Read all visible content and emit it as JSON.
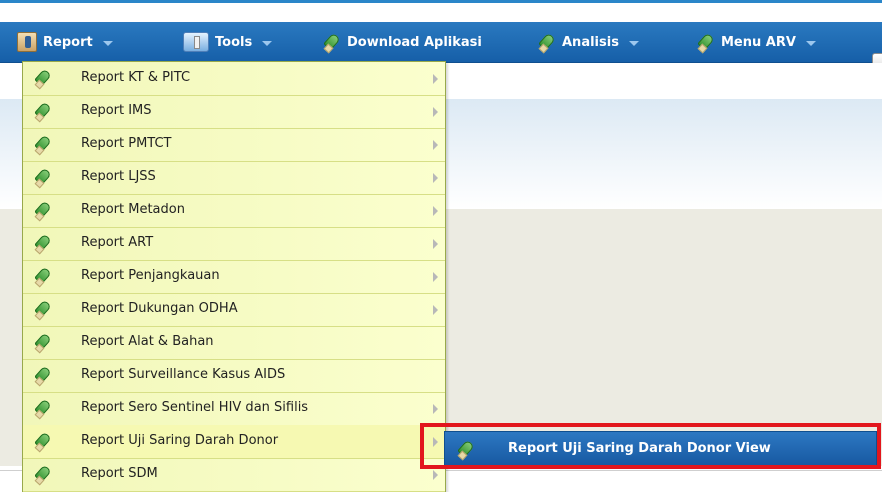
{
  "menubar": {
    "items": [
      {
        "label": "Report",
        "icon": "report-icon",
        "has_caret": true
      },
      {
        "label": "Tools",
        "icon": "tools-icon",
        "has_caret": true
      },
      {
        "label": "Download Aplikasi",
        "icon": "pencil-icon",
        "has_caret": false
      },
      {
        "label": "Analisis",
        "icon": "pencil-icon",
        "has_caret": true
      },
      {
        "label": "Menu ARV",
        "icon": "pencil-icon",
        "has_caret": true
      }
    ]
  },
  "report_menu": {
    "items": [
      {
        "label": "Report KT & PITC",
        "has_submenu": true
      },
      {
        "label": "Report IMS",
        "has_submenu": true
      },
      {
        "label": "Report PMTCT",
        "has_submenu": true
      },
      {
        "label": "Report LJSS",
        "has_submenu": true
      },
      {
        "label": "Report Metadon",
        "has_submenu": true
      },
      {
        "label": "Report ART",
        "has_submenu": true
      },
      {
        "label": "Report Penjangkauan",
        "has_submenu": true
      },
      {
        "label": "Report Dukungan ODHA",
        "has_submenu": true
      },
      {
        "label": "Report Alat & Bahan",
        "has_submenu": false
      },
      {
        "label": "Report Surveillance Kasus AIDS",
        "has_submenu": false
      },
      {
        "label": "Report Sero Sentinel HIV dan Sifilis",
        "has_submenu": true
      },
      {
        "label": "Report Uji Saring Darah Donor",
        "has_submenu": true
      },
      {
        "label": "Report SDM",
        "has_submenu": true
      }
    ]
  },
  "submenu": {
    "label": "Report Uji Saring Darah Donor View"
  },
  "colors": {
    "menubar": "#1f6cb4",
    "dropdown": "#f8fcc3",
    "submenu_highlight": "#1c63ac",
    "annotation_box": "#e2161d"
  }
}
